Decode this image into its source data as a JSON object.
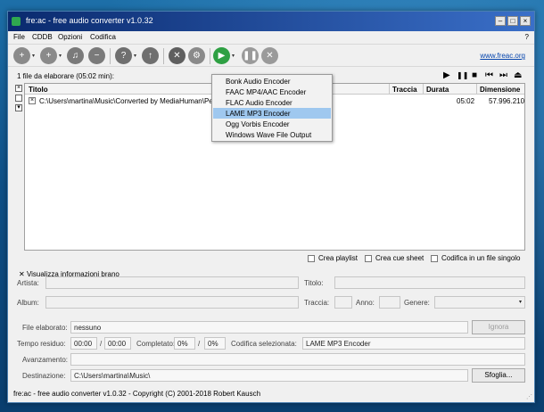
{
  "window": {
    "title": "fre:ac - free audio converter v1.0.32"
  },
  "title_buttons": {
    "minimize": "–",
    "maximize": "□",
    "close": "×"
  },
  "menu": {
    "file": "File",
    "cddb": "CDDB",
    "options": "Opzioni",
    "encode": "Codifica",
    "help": "?"
  },
  "toolbar": {
    "link": "www.freac.org"
  },
  "icons": {
    "add_files": "add-files-icon",
    "add_folder": "add-folder-icon",
    "cd_audio": "cd-audio-icon",
    "remove": "remove-icon",
    "cddb_query": "cddb-query-icon",
    "cddb_submit": "cddb-submit-icon",
    "tools": "tools-icon",
    "settings": "settings-icon",
    "start": "start-encoding-icon",
    "pause": "pause-icon",
    "stop": "stop-icon",
    "colors": {
      "start": "#2ea043",
      "gray": "#7a7a7a",
      "orange": "#d98c22"
    }
  },
  "status": {
    "files_to_process": "1 file da elaborare (05:02 min):"
  },
  "transport": {
    "play": "▶",
    "pause": "❚❚",
    "stop": "■",
    "prev": "⏮",
    "next": "⏭",
    "eject": "⏏"
  },
  "columns": {
    "title": "Titolo",
    "track": "Traccia",
    "duration": "Durata",
    "size": "Dimensione"
  },
  "rows": [
    {
      "checked": "×",
      "title": "C:\\Users\\martina\\Music\\Converted by MediaHuman\\Per",
      "duration": "05:02",
      "size": "57.996.210"
    }
  ],
  "side_checks": {
    "top": "×",
    "bottom": "▾"
  },
  "encoder_menu": {
    "items": [
      "Bonk Audio Encoder",
      "FAAC MP4/AAC Encoder",
      "FLAC Audio Encoder",
      "LAME MP3 Encoder",
      "Ogg Vorbis Encoder",
      "Windows Wave File Output"
    ],
    "selected": "LAME MP3 Encoder"
  },
  "options": {
    "playlist": "Crea playlist",
    "cue": "Crea cue sheet",
    "single_file": "Codifica in un file singolo"
  },
  "info": {
    "toggle": "Visualizza informazioni brano",
    "artist": "Artista:",
    "title": "Titolo:",
    "album": "Album:",
    "track": "Traccia:",
    "year": "Anno:",
    "genre": "Genere:"
  },
  "progress": {
    "file_label": "File elaborato:",
    "file_value": "nessuno",
    "ignore_button": "Ignora",
    "time_label": "Tempo residuo:",
    "time_a": "00:00",
    "time_sep": "/",
    "time_b": "00:00",
    "completed_label": "Completato:",
    "completed_a": "0%",
    "completed_b": "0%",
    "encoder_label": "Codifica selezionata:",
    "encoder_value": "LAME MP3 Encoder",
    "advance_label": "Avanzamento:",
    "dest_label": "Destinazione:",
    "dest_value": "C:\\Users\\martina\\Music\\",
    "browse_button": "Sfoglia..."
  },
  "statusbar": {
    "text": "fre:ac - free audio converter v1.0.32 - Copyright (C) 2001-2018 Robert Kausch"
  }
}
